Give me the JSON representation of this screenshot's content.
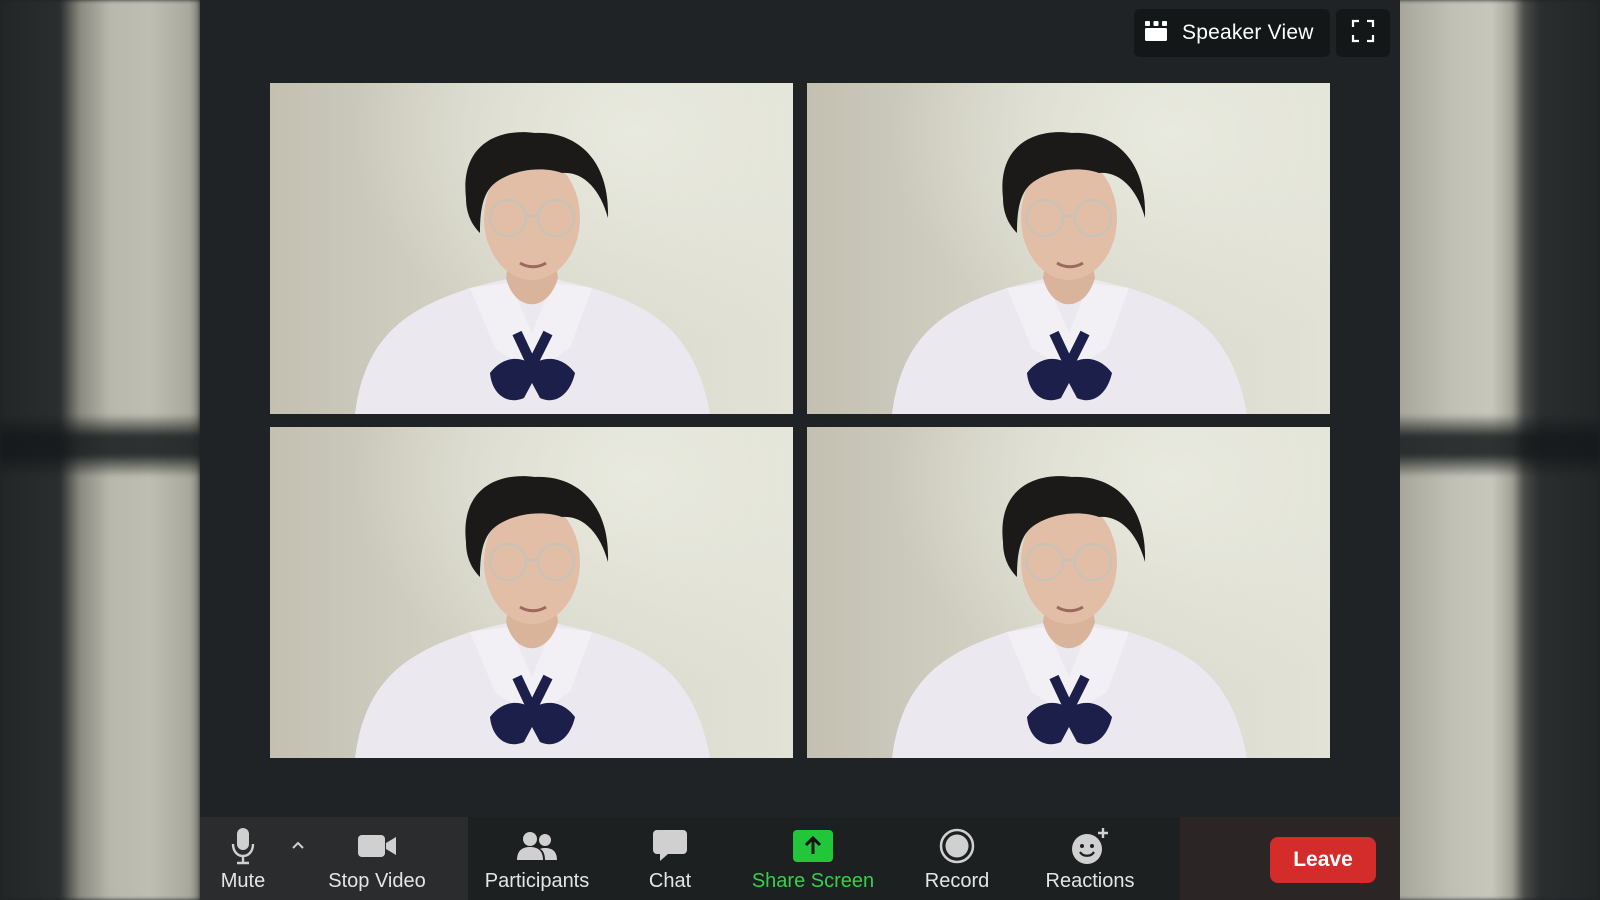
{
  "topbar": {
    "speaker_view_label": "Speaker View",
    "speaker_view_icon": "grid-icon",
    "fullscreen_icon": "fullscreen-icon"
  },
  "video_tiles": [
    {
      "id": "participant-1"
    },
    {
      "id": "participant-2"
    },
    {
      "id": "participant-3"
    },
    {
      "id": "participant-4"
    }
  ],
  "toolbar": {
    "mute_label": "Mute",
    "stop_video_label": "Stop Video",
    "participants_label": "Participants",
    "chat_label": "Chat",
    "share_screen_label": "Share Screen",
    "record_label": "Record",
    "reactions_label": "Reactions",
    "leave_label": "Leave"
  },
  "colors": {
    "share_screen_accent": "#35d04a",
    "leave_red": "#d42b2b",
    "background": "#1f2325"
  }
}
